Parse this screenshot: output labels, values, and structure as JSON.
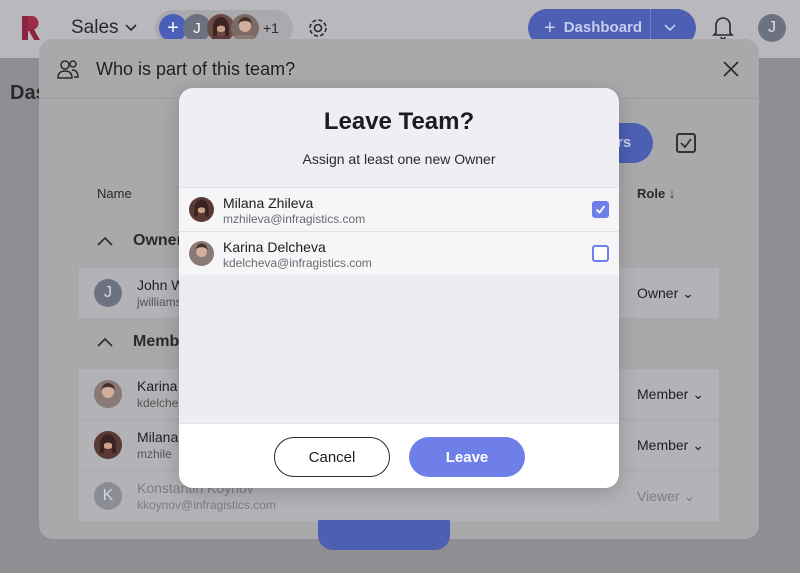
{
  "appbar": {
    "workspace": "Sales",
    "more_members": "+1",
    "user_initial": "J",
    "member_initial": "J",
    "dashboard_label": "Dashboard"
  },
  "page": {
    "title": "Das"
  },
  "team_dialog": {
    "title": "Who is part of this team?",
    "add_button": "rs",
    "col_name": "Name",
    "col_role": "Role",
    "group_owners": "Owner",
    "group_members": "Memb",
    "owners": [
      {
        "initial": "J",
        "name": "John W",
        "email": "jwilliams",
        "role": "Owner"
      }
    ],
    "members": [
      {
        "name": "Karina",
        "email": "kdelche",
        "role": "Member"
      },
      {
        "name": "Milana",
        "email": "mzhile",
        "role": "Member"
      },
      {
        "initial": "K",
        "name": "Konstantin Koynov",
        "email": "kkoynov@infragistics.com",
        "role": "Viewer"
      }
    ]
  },
  "leave_modal": {
    "title": "Leave Team?",
    "subtitle": "Assign at least one new Owner",
    "candidates": [
      {
        "name": "Milana Zhileva",
        "email": "mzhileva@infragistics.com",
        "checked": true
      },
      {
        "name": "Karina Delcheva",
        "email": "kdelcheva@infragistics.com",
        "checked": false
      }
    ],
    "cancel_label": "Cancel",
    "leave_label": "Leave"
  },
  "colors": {
    "accent": "#6f7fe9",
    "brand": "#e0245e"
  }
}
